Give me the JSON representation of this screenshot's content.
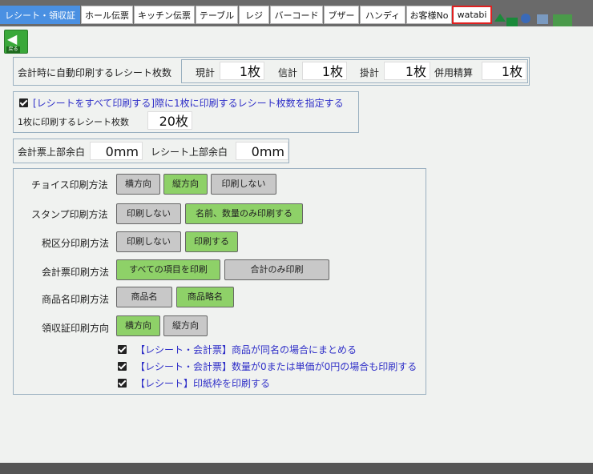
{
  "tabs": [
    {
      "label": "レシート・領収証"
    },
    {
      "label": "ホール伝票"
    },
    {
      "label": "キッチン伝票"
    },
    {
      "label": "テーブル"
    },
    {
      "label": "レジ"
    },
    {
      "label": "バーコード"
    },
    {
      "label": "ブザー"
    },
    {
      "label": "ハンディ"
    },
    {
      "label": "お客様No"
    },
    {
      "label": "watabi"
    }
  ],
  "back_button": {
    "label": "戻る"
  },
  "receipt_counts": {
    "title": "会計時に自動印刷するレシート枚数",
    "items": [
      {
        "label": "現計",
        "value": "1枚"
      },
      {
        "label": "信計",
        "value": "1枚"
      },
      {
        "label": "掛計",
        "value": "1枚"
      },
      {
        "label": "併用精算",
        "value": "1枚"
      }
    ]
  },
  "print_all": {
    "checked": true,
    "label": "[レシートをすべて印刷する]際に1枚に印刷するレシート枚数を指定する",
    "sub_label": "1枚に印刷するレシート枚数",
    "value": "20枚"
  },
  "margins": {
    "bill_label": "会計票上部余白",
    "bill_value": "0mm",
    "receipt_label": "レシート上部余白",
    "receipt_value": "0mm"
  },
  "methods": [
    {
      "label": "チョイス印刷方法",
      "options": [
        {
          "text": "横方向",
          "selected": false
        },
        {
          "text": "縦方向",
          "selected": true
        },
        {
          "text": "印刷しない",
          "selected": false
        }
      ]
    },
    {
      "label": "スタンプ印刷方法",
      "options": [
        {
          "text": "印刷しない",
          "selected": false
        },
        {
          "text": "名前、数量のみ印刷する",
          "selected": true
        }
      ]
    },
    {
      "label": "税区分印刷方法",
      "options": [
        {
          "text": "印刷しない",
          "selected": false
        },
        {
          "text": "印刷する",
          "selected": true
        }
      ]
    },
    {
      "label": "会計票印刷方法",
      "options": [
        {
          "text": "すべての項目を印刷",
          "selected": true
        },
        {
          "text": "合計のみ印刷",
          "selected": false
        }
      ]
    },
    {
      "label": "商品名印刷方法",
      "options": [
        {
          "text": "商品名",
          "selected": false
        },
        {
          "text": "商品略名",
          "selected": true
        }
      ]
    },
    {
      "label": "領収証印刷方向",
      "options": [
        {
          "text": "横方向",
          "selected": true
        },
        {
          "text": "縦方向",
          "selected": false
        }
      ]
    }
  ],
  "checkboxes": [
    {
      "checked": true,
      "label": "【レシート・会計票】商品が同名の場合にまとめる"
    },
    {
      "checked": true,
      "label": "【レシート・会計票】数量が0または単価が0円の場合も印刷する"
    },
    {
      "checked": true,
      "label": "【レシート】印紙枠を印刷する"
    }
  ],
  "colors": {
    "active_tab": "#4a90e2",
    "selected_option": "#8ed168",
    "unselected_option": "#c8c8c8",
    "link_text": "#3030c8",
    "highlight_border": "#e02020"
  }
}
